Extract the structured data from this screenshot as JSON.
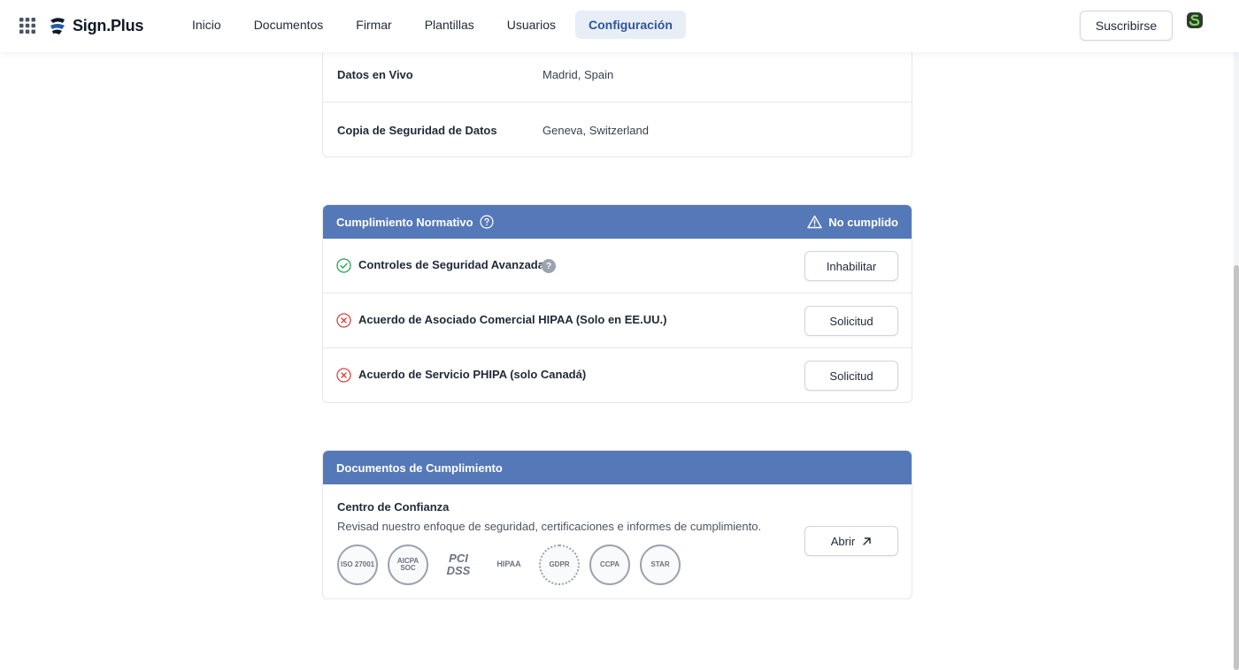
{
  "app": {
    "logo_text": "Sign.Plus"
  },
  "nav": {
    "items": [
      {
        "label": "Inicio"
      },
      {
        "label": "Documentos"
      },
      {
        "label": "Firmar"
      },
      {
        "label": "Plantillas"
      },
      {
        "label": "Usuarios"
      },
      {
        "label": "Configuración",
        "active": true
      }
    ],
    "subscribe_label": "Suscribirse"
  },
  "data_location": {
    "rows": [
      {
        "label": "Datos en Vivo",
        "value": "Madrid, Spain"
      },
      {
        "label": "Copia de Seguridad de Datos",
        "value": "Geneva, Switzerland"
      }
    ]
  },
  "compliance": {
    "title": "Cumplimiento Normativo",
    "status": "No cumplido",
    "rows": [
      {
        "label": "Controles de Seguridad Avanzada",
        "state": "enabled",
        "button": "Inhabilitar"
      },
      {
        "label": "Acuerdo de Asociado Comercial HIPAA (Solo en EE.UU.)",
        "state": "missing",
        "button": "Solicitud"
      },
      {
        "label": "Acuerdo de Servicio PHIPA (solo Canadá)",
        "state": "missing",
        "button": "Solicitud"
      }
    ]
  },
  "documents": {
    "title": "Documentos de Cumplimiento",
    "trust_center_title": "Centro de Confianza",
    "trust_center_desc": "Revisad nuestro enfoque de seguridad, certificaciones e informes de cumplimiento.",
    "open_label": "Abrir",
    "badges": [
      {
        "label": "ISO 27001"
      },
      {
        "label": "AICPA SOC"
      },
      {
        "label": "PCI DSS"
      },
      {
        "label": "HIPAA"
      },
      {
        "label": "GDPR"
      },
      {
        "label": "CCPA"
      },
      {
        "label": "STAR"
      }
    ]
  },
  "colors": {
    "header_blue": "#5578b8",
    "active_nav_text": "#2f5597",
    "success": "#22a356",
    "error": "#d9433b"
  },
  "icons": {
    "apps": "grid-icon",
    "help": "question-circle-icon",
    "warning": "warning-triangle-icon",
    "check": "check-circle-icon",
    "error": "x-circle-icon",
    "external": "arrow-up-right-icon"
  }
}
